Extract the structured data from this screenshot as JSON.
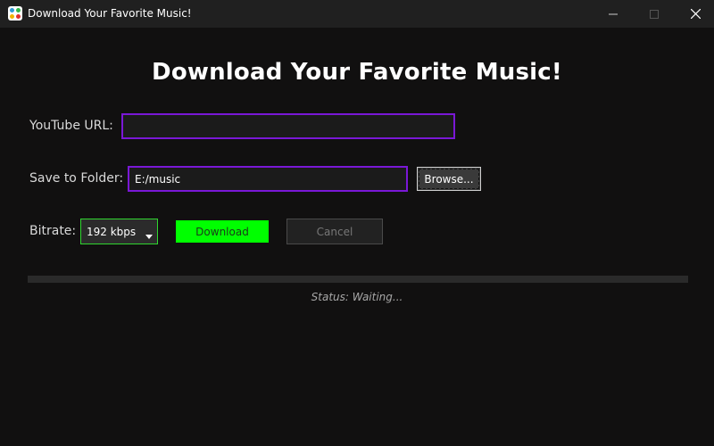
{
  "window": {
    "title": "Download Your Favorite Music!",
    "icon": "app-dots-icon",
    "controls": [
      "minimize-icon",
      "maximize-icon",
      "close-icon"
    ]
  },
  "heading": "Download Your Favorite Music!",
  "url": {
    "label": "YouTube URL:",
    "value": "",
    "placeholder": ""
  },
  "folder": {
    "label": "Save to Folder:",
    "value": "E:/music",
    "browse_label": "Browse..."
  },
  "bitrate": {
    "label": "Bitrate:",
    "selected": "192 kbps"
  },
  "actions": {
    "download_label": "Download",
    "cancel_label": "Cancel"
  },
  "progress": {
    "fraction": 0
  },
  "status": "Status: Waiting...",
  "colors": {
    "background": "#111010",
    "input_border": "#7a18d6",
    "accent_green": "#00ff00",
    "select_border": "#2fd62f"
  }
}
